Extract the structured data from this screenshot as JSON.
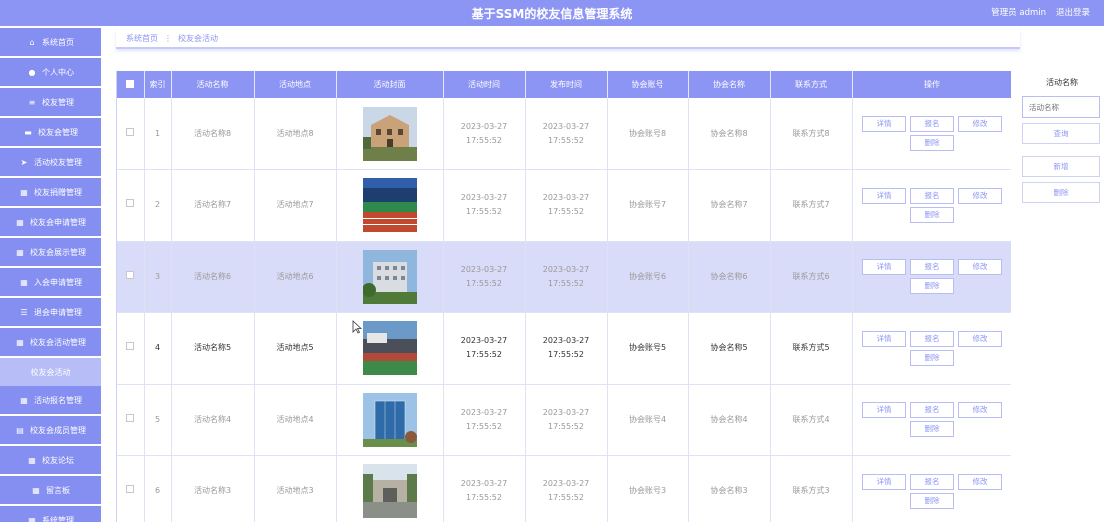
{
  "header": {
    "title": "基于SSM的校友信息管理系统",
    "user_label": "管理员 admin",
    "logout_label": "退出登录"
  },
  "sidebar": {
    "items": [
      {
        "label": "系统首页",
        "icon": "home-icon",
        "glyph": "⌂"
      },
      {
        "label": "个人中心",
        "icon": "user-icon",
        "glyph": "●"
      },
      {
        "label": "校友管理",
        "icon": "list-icon",
        "glyph": "≡"
      },
      {
        "label": "校友会管理",
        "icon": "chat-icon",
        "glyph": "▬"
      },
      {
        "label": "活动校友管理",
        "icon": "send-icon",
        "glyph": "➤"
      },
      {
        "label": "校友捐赠管理",
        "icon": "grid-icon",
        "glyph": "▦"
      },
      {
        "label": "校友会申请管理",
        "icon": "grid-icon",
        "glyph": "▦"
      },
      {
        "label": "校友会展示管理",
        "icon": "grid-icon",
        "glyph": "▦"
      },
      {
        "label": "入会申请管理",
        "icon": "grid-icon",
        "glyph": "▦"
      },
      {
        "label": "退会申请管理",
        "icon": "list-icon",
        "glyph": "☰"
      },
      {
        "label": "校友会活动管理",
        "icon": "grid-icon",
        "glyph": "▦"
      },
      {
        "label": "校友会活动",
        "icon": "",
        "glyph": ""
      },
      {
        "label": "活动报名管理",
        "icon": "grid-icon",
        "glyph": "▦"
      },
      {
        "label": "校友会成员管理",
        "icon": "clipboard-icon",
        "glyph": "▤"
      },
      {
        "label": "校友论坛",
        "icon": "grid-icon",
        "glyph": "▦"
      },
      {
        "label": "留言板",
        "icon": "grid-icon",
        "glyph": "▦"
      },
      {
        "label": "系统管理",
        "icon": "grid-icon",
        "glyph": "▦"
      }
    ]
  },
  "breadcrumb": {
    "home": "系统首页",
    "separator": "⋮",
    "current": "校友会活动"
  },
  "table": {
    "headers": [
      "",
      "索引",
      "活动名称",
      "活动地点",
      "活动封面",
      "活动时间",
      "发布时间",
      "协会账号",
      "协会名称",
      "联系方式",
      "操作"
    ],
    "rows": [
      {
        "index": "1",
        "name": "活动名称8",
        "place": "活动地点8",
        "start": "2023-03-27 17:55:52",
        "publish": "2023-03-27 17:55:52",
        "account": "协会账号8",
        "assoc": "协会名称8",
        "contact": "联系方式8",
        "cover": "building",
        "state": "normal"
      },
      {
        "index": "2",
        "name": "活动名称7",
        "place": "活动地点7",
        "start": "2023-03-27 17:55:52",
        "publish": "2023-03-27 17:55:52",
        "account": "协会账号7",
        "assoc": "协会名称7",
        "contact": "联系方式7",
        "cover": "track",
        "state": "normal"
      },
      {
        "index": "3",
        "name": "活动名称6",
        "place": "活动地点6",
        "start": "2023-03-27 17:55:52",
        "publish": "2023-03-27 17:55:52",
        "account": "协会账号6",
        "assoc": "协会名称6",
        "contact": "联系方式6",
        "cover": "campus",
        "state": "selected"
      },
      {
        "index": "4",
        "name": "活动名称5",
        "place": "活动地点5",
        "start": "2023-03-27 17:55:52",
        "publish": "2023-03-27 17:55:52",
        "account": "协会账号5",
        "assoc": "协会名称5",
        "contact": "联系方式5",
        "cover": "stadium",
        "state": "hover"
      },
      {
        "index": "5",
        "name": "活动名称4",
        "place": "活动地点4",
        "start": "2023-03-27 17:55:52",
        "publish": "2023-03-27 17:55:52",
        "account": "协会账号4",
        "assoc": "协会名称4",
        "contact": "联系方式4",
        "cover": "glass",
        "state": "normal"
      },
      {
        "index": "6",
        "name": "活动名称3",
        "place": "活动地点3",
        "start": "2023-03-27 17:55:52",
        "publish": "2023-03-27 17:55:52",
        "account": "协会账号3",
        "assoc": "协会名称3",
        "contact": "联系方式3",
        "cover": "gate",
        "state": "normal"
      }
    ],
    "actions": {
      "detail": "详情",
      "signup": "报名",
      "edit": "修改",
      "delete": "删除"
    }
  },
  "search_panel": {
    "label": "活动名称",
    "placeholder": "活动名称",
    "query_button": "查询",
    "add_button": "新增",
    "delete_button": "删除"
  },
  "colors": {
    "accent": "#8c95f3",
    "sidebar": "#858ff1",
    "sidebar_active": "#b7bdf7",
    "row_selected": "#d9dcf8"
  }
}
